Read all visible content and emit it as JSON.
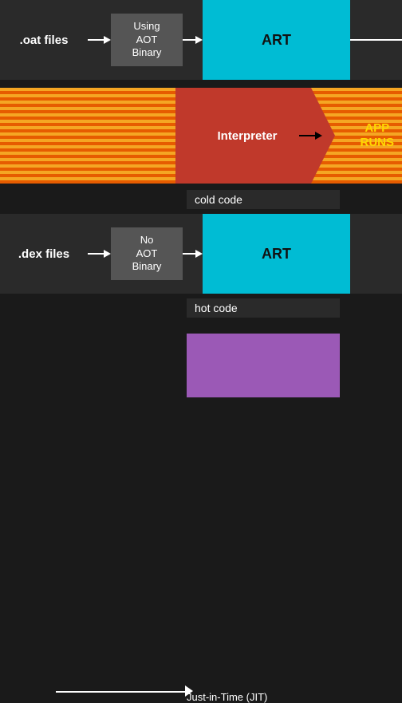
{
  "section1": {
    "file_label": ".oat files",
    "aot_box_label": "Using\nAOT\nBinary",
    "art_label": "ART"
  },
  "section2": {
    "interpreter_label": "Interpreter",
    "app_runs_label": "APP\nRUNS"
  },
  "cold_code": {
    "label": "cold code"
  },
  "section3": {
    "file_label": ".dex files",
    "aot_box_label": "No\nAOT\nBinary",
    "art_label": "ART"
  },
  "hot_code": {
    "label": "hot code"
  },
  "section4": {
    "jit_label": "Just-in-Time (JIT)"
  },
  "colors": {
    "cyan": "#00bcd4",
    "dark": "#2a2a2a",
    "red": "#c0392b",
    "orange_stripe_dark": "#e65c00",
    "orange_stripe_light": "#f5a623",
    "purple": "#9b59b6",
    "gold": "#ffd700"
  }
}
